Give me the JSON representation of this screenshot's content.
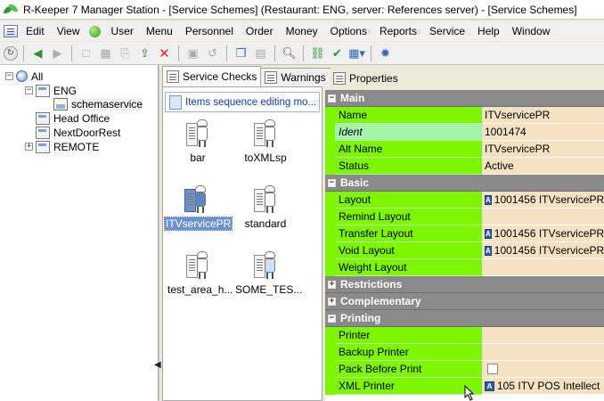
{
  "window": {
    "title": "R-Keeper 7 Manager Station - [Service Schemes] (Restaurant: ENG, server: References server) - [Service Schemes]"
  },
  "menu": {
    "items": [
      "Edit",
      "View",
      "User",
      "Menu",
      "Personnel",
      "Order",
      "Money",
      "Options",
      "Reports",
      "Service",
      "Help",
      "Window"
    ]
  },
  "toolbar": {
    "icons": [
      "refresh-icon",
      "back-icon",
      "forward-icon",
      "new-icon",
      "new-folder-icon",
      "copy-icon",
      "export-icon",
      "delete-icon",
      "save-icon",
      "undo-icon",
      "duplicate-icon",
      "paste-icon",
      "search-icon",
      "link-icon",
      "check-icon",
      "grid-icon",
      "settings-icon"
    ]
  },
  "tree": {
    "nodes": [
      {
        "label": "All"
      },
      {
        "label": "ENG"
      },
      {
        "label": "schemaservice"
      },
      {
        "label": "Head Office"
      },
      {
        "label": "NextDoorRest"
      },
      {
        "label": "REMOTE"
      }
    ]
  },
  "tabs": {
    "service_checks": "Service Checks",
    "warnings": "Warnings",
    "properties": "Properties"
  },
  "schemes": {
    "sequence_bar": "Items sequence editing mo...",
    "items": [
      {
        "label": "bar"
      },
      {
        "label": "toXMLsp"
      },
      {
        "label": "ITVservicePR"
      },
      {
        "label": "standard"
      },
      {
        "label": "test_area_h..."
      },
      {
        "label": "SOME_TES..."
      }
    ]
  },
  "properties": {
    "sections": {
      "main": "Main",
      "basic": "Basic",
      "restrictions": "Restrictions",
      "complementary": "Complementary",
      "printing": "Printing"
    },
    "main": [
      {
        "name": "Name",
        "value": "ITVservicePR"
      },
      {
        "name": "Ident",
        "value": "1001474"
      },
      {
        "name": "Alt Name",
        "value": "ITVservicePR"
      },
      {
        "name": "Status",
        "value": "Active"
      }
    ],
    "basic": [
      {
        "name": "Layout",
        "value": "1001456 ITVservicePR"
      },
      {
        "name": "Remind Layout",
        "value": ""
      },
      {
        "name": "Transfer Layout",
        "value": "1001456 ITVservicePR"
      },
      {
        "name": "Void Layout",
        "value": "1001456 ITVservicePR"
      },
      {
        "name": "Weight Layout",
        "value": ""
      }
    ],
    "printing": [
      {
        "name": "Printer",
        "value": ""
      },
      {
        "name": "Backup Printer",
        "value": ""
      },
      {
        "name": "Pack Before Print",
        "value": ""
      },
      {
        "name": "XML Printer",
        "value": "105 ITV POS Intellect"
      }
    ]
  },
  "colors": {
    "property_name_bg": "#7cf700",
    "property_value_bg": "#f5e2c3",
    "section_bg": "#8a8a8a",
    "selection_bg": "#6c92d0"
  }
}
